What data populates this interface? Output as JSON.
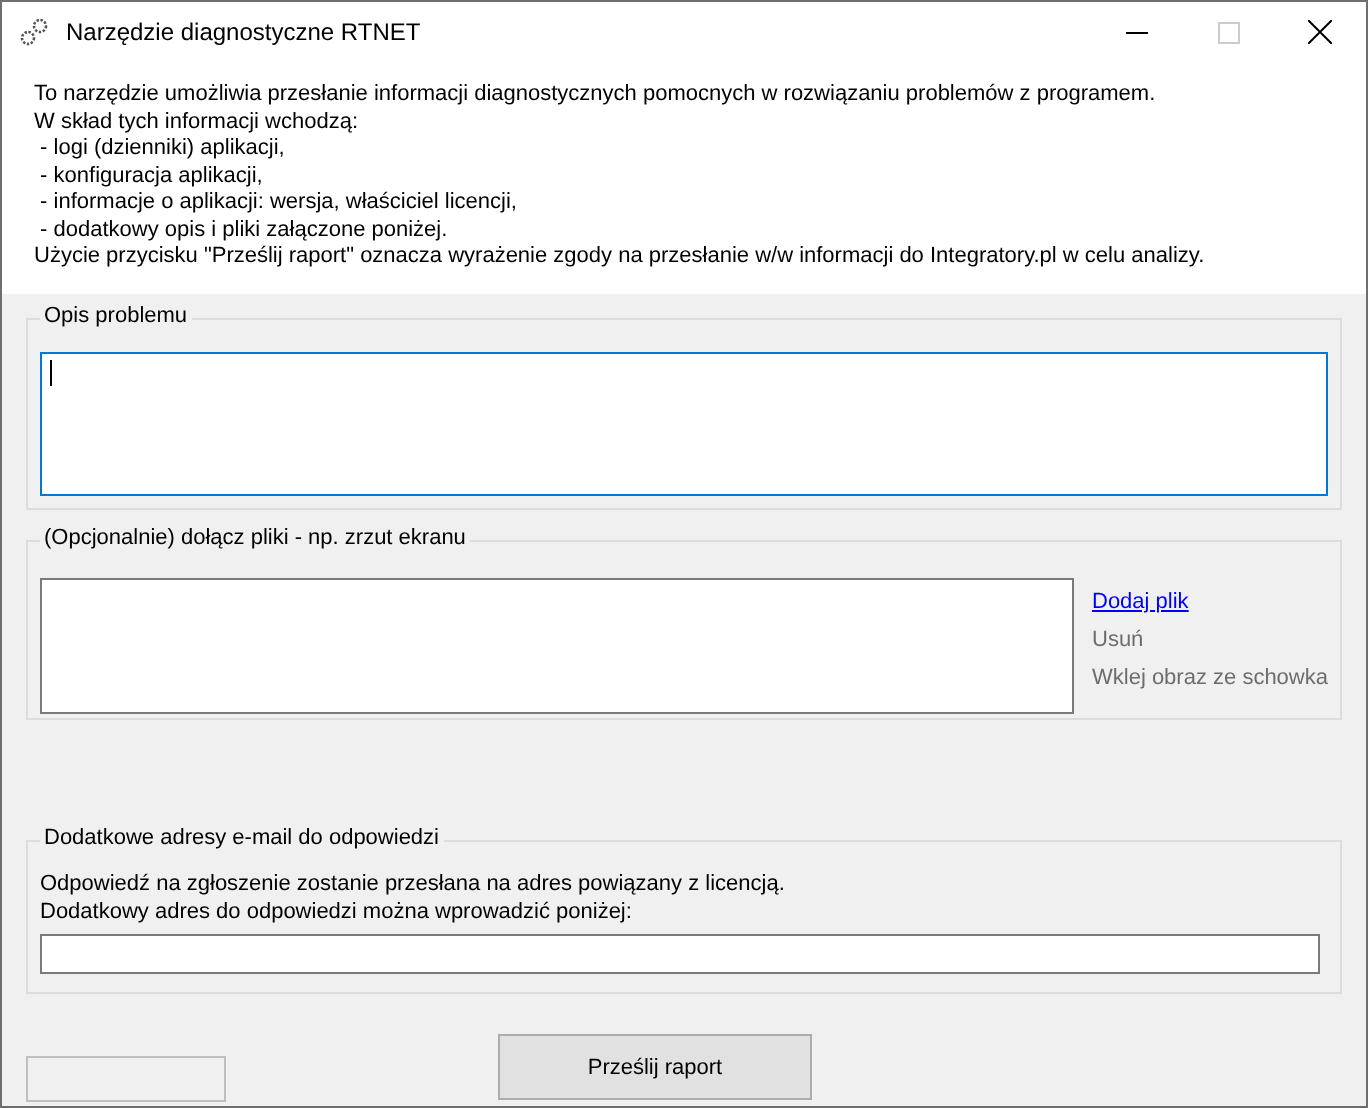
{
  "window": {
    "title": "Narzędzie diagnostyczne RTNET"
  },
  "intro": [
    "To narzędzie umożliwia przesłanie informacji diagnostycznych pomocnych w rozwiązaniu problemów z programem.",
    "W skład tych informacji wchodzą:",
    " - logi (dzienniki) aplikacji,",
    " - konfiguracja aplikacji,",
    " - informacje o aplikacji: wersja, właściciel licencji,",
    " - dodatkowy opis i pliki załączone poniżej.",
    "Użycie przycisku \"Prześlij raport\" oznacza wyrażenie zgody na przesłanie w/w informacji do Integratory.pl w celu analizy."
  ],
  "description": {
    "title": "Opis problemu",
    "focused": true
  },
  "attachments": {
    "title": "(Opcjonalnie) dołącz pliki - np. zrzut ekranu",
    "actions": [
      {
        "label": "Dodaj plik",
        "disabled": false
      },
      {
        "label": "Usuń",
        "disabled": true
      },
      {
        "label": "Wklej obraz ze schowka",
        "disabled": true
      }
    ]
  },
  "email": {
    "title": "Dodatkowe adresy e-mail do odpowiedzi",
    "lines": [
      "Odpowiedź na zgłoszenie zostanie przesłana na adres powiązany z licencją.",
      "Dodatkowy adres do odpowiedzi można wprowadzić poniżej:"
    ]
  },
  "buttons": [
    {
      "disabled": true
    },
    {
      "label": "Prześlij raport",
      "disabled": false
    }
  ]
}
